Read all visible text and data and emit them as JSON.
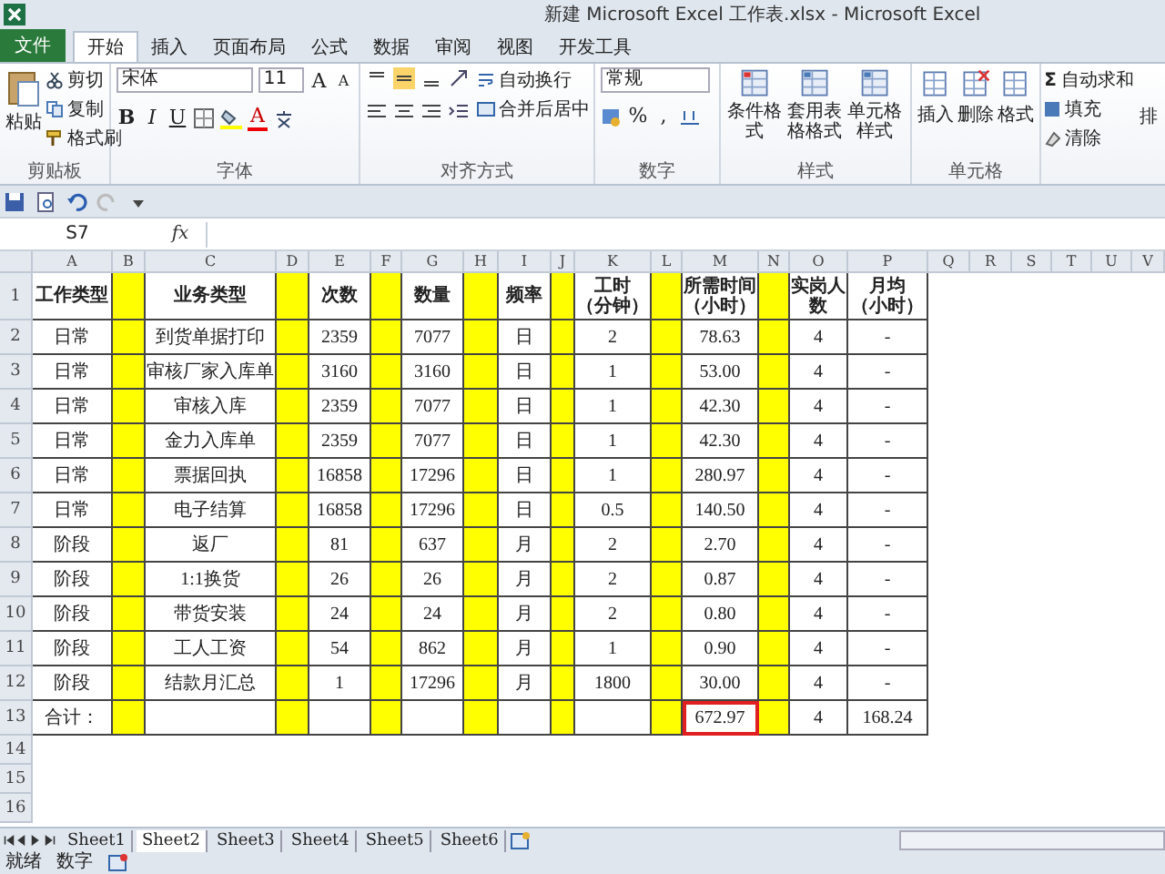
{
  "window": {
    "title": "新建 Microsoft Excel 工作表.xlsx - Microsoft Excel"
  },
  "menu_tabs": [
    {
      "label": "文件",
      "kind": "file",
      "selected": false
    },
    {
      "label": "开始",
      "kind": "tab",
      "selected": true
    },
    {
      "label": "插入",
      "kind": "tab",
      "selected": false
    },
    {
      "label": "页面布局",
      "kind": "tab",
      "selected": false
    },
    {
      "label": "公式",
      "kind": "tab",
      "selected": false
    },
    {
      "label": "数据",
      "kind": "tab",
      "selected": false
    },
    {
      "label": "审阅",
      "kind": "tab",
      "selected": false
    },
    {
      "label": "视图",
      "kind": "tab",
      "selected": false
    },
    {
      "label": "开发工具",
      "kind": "tab",
      "selected": false
    }
  ],
  "ribbon": {
    "clipboard": {
      "paste": "粘贴",
      "cut": "剪切",
      "copy": "复制",
      "format_painter": "格式刷",
      "label": "剪贴板"
    },
    "font": {
      "name": "宋体",
      "size": "11",
      "grow": "A",
      "shrink": "A",
      "bold": "B",
      "italic": "I",
      "underline": "U",
      "font_color": "A",
      "label": "字体"
    },
    "alignment": {
      "wrap": "自动换行",
      "merge": "合并后居中",
      "label": "对齐方式"
    },
    "number": {
      "format": "常规",
      "percent": "%",
      "comma": ",",
      "label": "数字"
    },
    "styles": {
      "buttons": [
        "条件格式",
        "套用表格格式",
        "单元格样式"
      ],
      "label": "样式"
    },
    "cells": {
      "buttons": [
        "插入",
        "删除",
        "格式"
      ],
      "label": "单元格"
    },
    "editing": {
      "sum": "Σ",
      "items": [
        "自动求和",
        "填充",
        "清除"
      ],
      "cut_label": "排"
    }
  },
  "formula_bar": {
    "name_box": "S7",
    "function_label": "fx"
  },
  "sheet": {
    "columns": [
      {
        "letter": "A",
        "kind": "data"
      },
      {
        "letter": "B",
        "kind": "spacer"
      },
      {
        "letter": "C",
        "kind": "data"
      },
      {
        "letter": "D",
        "kind": "spacer"
      },
      {
        "letter": "E",
        "kind": "data"
      },
      {
        "letter": "F",
        "kind": "spacer"
      },
      {
        "letter": "G",
        "kind": "data"
      },
      {
        "letter": "H",
        "kind": "spacer"
      },
      {
        "letter": "I",
        "kind": "data"
      },
      {
        "letter": "J",
        "kind": "spacer"
      },
      {
        "letter": "K",
        "kind": "data"
      },
      {
        "letter": "L",
        "kind": "spacer"
      },
      {
        "letter": "M",
        "kind": "data"
      },
      {
        "letter": "N",
        "kind": "spacer"
      },
      {
        "letter": "O",
        "kind": "data"
      },
      {
        "letter": "P",
        "kind": "data"
      },
      {
        "letter": "Q",
        "kind": "empty"
      },
      {
        "letter": "R",
        "kind": "empty"
      },
      {
        "letter": "S",
        "kind": "empty"
      },
      {
        "letter": "T",
        "kind": "empty"
      },
      {
        "letter": "U",
        "kind": "empty"
      },
      {
        "letter": "V",
        "kind": "empty"
      }
    ],
    "rows": [
      {
        "number": "1",
        "kind": "header",
        "cells": [
          [
            "工作类型"
          ],
          [
            "业务类型"
          ],
          [
            "次数"
          ],
          [
            "数量"
          ],
          [
            "频率"
          ],
          [
            "工时",
            "（分钟）"
          ],
          [
            "所需时间",
            "（小时）"
          ],
          [
            "实岗人",
            "数"
          ],
          [
            "月均",
            "（小时）"
          ]
        ]
      },
      {
        "number": "2",
        "kind": "data",
        "cells": [
          "日常",
          "到货单据打印",
          "2359",
          "7077",
          "日",
          "2",
          "78.63",
          "4",
          "-"
        ]
      },
      {
        "number": "3",
        "kind": "data",
        "cells": [
          "日常",
          "审核厂家入库单",
          "3160",
          "3160",
          "日",
          "1",
          "53.00",
          "4",
          "-"
        ]
      },
      {
        "number": "4",
        "kind": "data",
        "cells": [
          "日常",
          "审核入库",
          "2359",
          "7077",
          "日",
          "1",
          "42.30",
          "4",
          "-"
        ]
      },
      {
        "number": "5",
        "kind": "data",
        "cells": [
          "日常",
          "金力入库单",
          "2359",
          "7077",
          "日",
          "1",
          "42.30",
          "4",
          "-"
        ]
      },
      {
        "number": "6",
        "kind": "data",
        "cells": [
          "日常",
          "票据回执",
          "16858",
          "17296",
          "日",
          "1",
          "280.97",
          "4",
          "-"
        ]
      },
      {
        "number": "7",
        "kind": "data",
        "cells": [
          "日常",
          "电子结算",
          "16858",
          "17296",
          "日",
          "0.5",
          "140.50",
          "4",
          "-"
        ]
      },
      {
        "number": "8",
        "kind": "data",
        "cells": [
          "阶段",
          "返厂",
          "81",
          "637",
          "月",
          "2",
          "2.70",
          "4",
          "-"
        ]
      },
      {
        "number": "9",
        "kind": "data",
        "cells": [
          "阶段",
          "1:1换货",
          "26",
          "26",
          "月",
          "2",
          "0.87",
          "4",
          "-"
        ]
      },
      {
        "number": "10",
        "kind": "data",
        "cells": [
          "阶段",
          "带货安装",
          "24",
          "24",
          "月",
          "2",
          "0.80",
          "4",
          "-"
        ]
      },
      {
        "number": "11",
        "kind": "data",
        "cells": [
          "阶段",
          "工人工资",
          "54",
          "862",
          "月",
          "1",
          "0.90",
          "4",
          "-"
        ]
      },
      {
        "number": "12",
        "kind": "data",
        "cells": [
          "阶段",
          "结款月汇总",
          "1",
          "17296",
          "月",
          "1800",
          "30.00",
          "4",
          "-"
        ]
      },
      {
        "number": "13",
        "kind": "data",
        "cells": [
          "合计：",
          null,
          null,
          null,
          null,
          null,
          {
            "text": "672.97",
            "selected": true
          },
          "4",
          "168.24"
        ]
      },
      {
        "number": "14",
        "kind": "empty"
      },
      {
        "number": "15",
        "kind": "empty"
      },
      {
        "number": "16",
        "kind": "empty"
      }
    ]
  },
  "sheet_tabs": [
    {
      "label": "Sheet1",
      "selected": false
    },
    {
      "label": "Sheet2",
      "selected": true
    },
    {
      "label": "Sheet3",
      "selected": false
    },
    {
      "label": "Sheet4",
      "selected": false
    },
    {
      "label": "Sheet5",
      "selected": false
    },
    {
      "label": "Sheet6",
      "selected": false
    }
  ],
  "status_bar": {
    "items": [
      "就绪",
      "数字"
    ]
  }
}
